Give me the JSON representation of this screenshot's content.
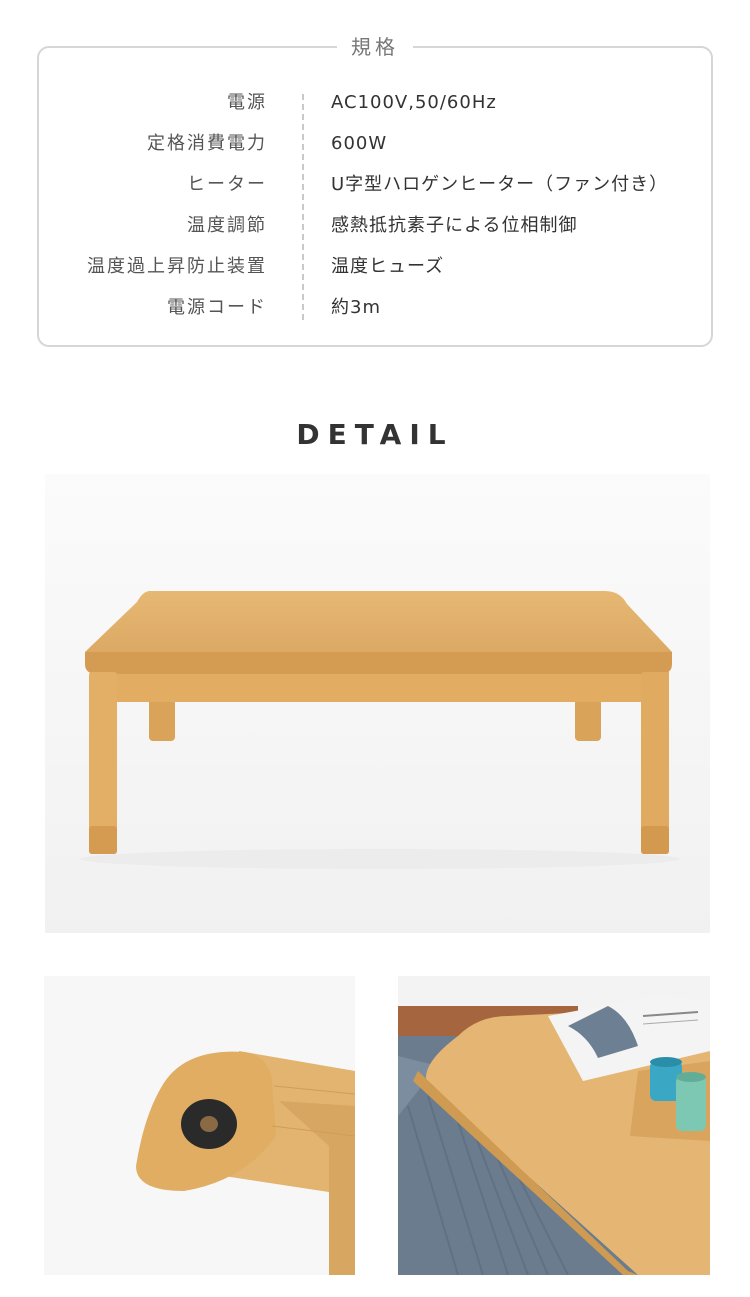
{
  "spec": {
    "title": "規格",
    "rows": [
      {
        "label": "電源",
        "value": "AC100V,50/60Hz"
      },
      {
        "label": "定格消費電力",
        "value": "600W"
      },
      {
        "label": "ヒーター",
        "value": "U字型ハロゲンヒーター（ファン付き）"
      },
      {
        "label": "温度調節",
        "value": "感熱抵抗素子による位相制御"
      },
      {
        "label": "温度過上昇防止装置",
        "value": "温度ヒューズ"
      },
      {
        "label": "電源コード",
        "value": "約3m"
      }
    ]
  },
  "detail": {
    "title": "DETAIL"
  },
  "colors": {
    "wood": "#e3b265",
    "wood_dark": "#c99647",
    "border": "#d6d6d6"
  }
}
